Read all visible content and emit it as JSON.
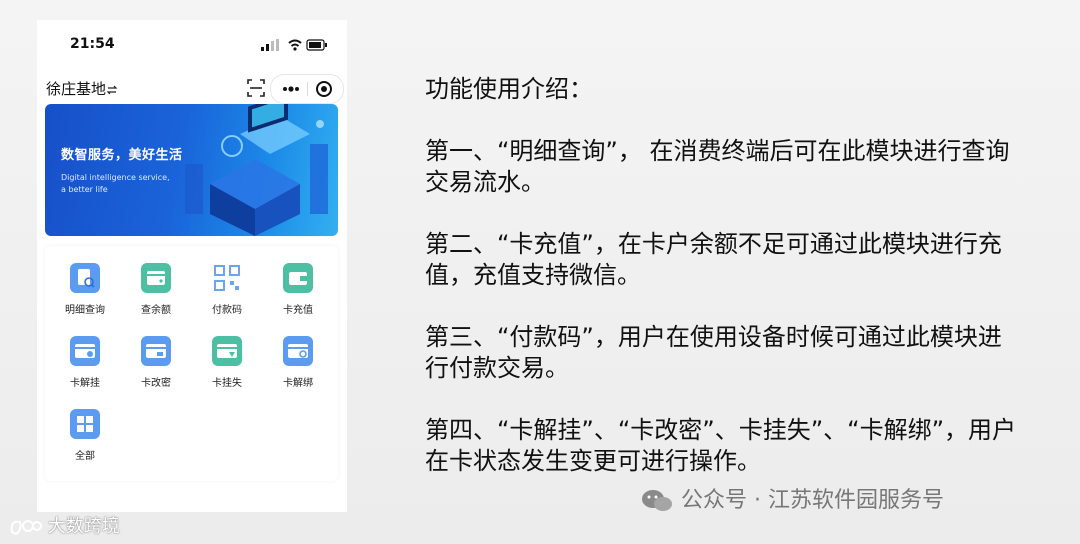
{
  "status": {
    "time": "21:54"
  },
  "app": {
    "title": "徐庄基地"
  },
  "banner": {
    "title": "数智服务，美好生活",
    "subtitle": "Digital intelligence service, a better life"
  },
  "functions": [
    {
      "label": "明细查询",
      "icon": "receipt-search-icon",
      "color": "#5b9cf0"
    },
    {
      "label": "查余额",
      "icon": "wallet-icon",
      "color": "#4dbfa3"
    },
    {
      "label": "付款码",
      "icon": "qr-code-icon",
      "color": "#69a6f0"
    },
    {
      "label": "卡充值",
      "icon": "card-wallet-icon",
      "color": "#4dbfa3"
    },
    {
      "label": "卡解挂",
      "icon": "card-unlock-icon",
      "color": "#5b9cf0"
    },
    {
      "label": "卡改密",
      "icon": "card-password-icon",
      "color": "#5b9cf0"
    },
    {
      "label": "卡挂失",
      "icon": "card-lost-icon",
      "color": "#4dbfa3"
    },
    {
      "label": "卡解绑",
      "icon": "card-unbind-icon",
      "color": "#5b9cf0"
    },
    {
      "label": "全部",
      "icon": "all-apps-icon",
      "color": "#5b9cf0"
    }
  ],
  "description": {
    "heading": "功能使用介绍：",
    "paragraphs": [
      "第一、“明细查询”， 在消费终端后可在此模块进行查询交易流水。",
      "第二、“卡充值”，在卡户余额不足可通过此模块进行充值，充值支持微信。",
      "第三、“付款码”，用户在使用设备时候可通过此模块进行付款交易。",
      "第四、“卡解挂”、“卡改密”、卡挂失”、“卡解绑”，用户在卡状态发生变更可进行操作。"
    ]
  },
  "watermarks": {
    "left": "大数跨境",
    "right": "公众号 · 江苏软件园服务号"
  }
}
